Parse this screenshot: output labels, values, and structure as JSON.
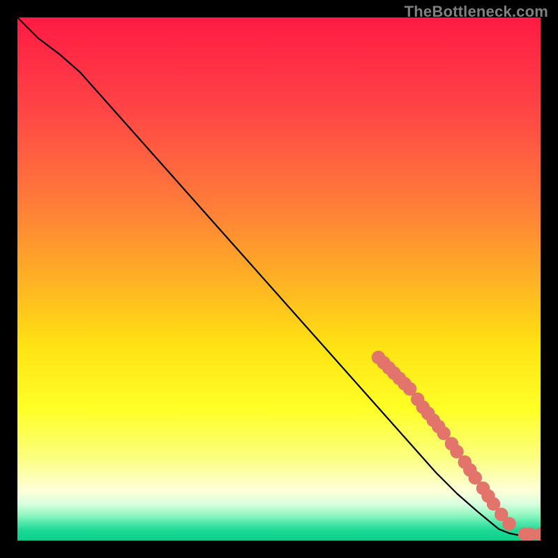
{
  "watermark": "TheBottleneck.com",
  "chart_data": {
    "type": "line",
    "title": "",
    "xlabel": "",
    "ylabel": "",
    "xlim": [
      0,
      100
    ],
    "ylim": [
      0,
      100
    ],
    "grid": false,
    "legend": false,
    "series": [
      {
        "name": "curve",
        "x": [
          0,
          4,
          8,
          12,
          16,
          20,
          24,
          28,
          32,
          36,
          40,
          44,
          48,
          52,
          56,
          60,
          64,
          68,
          72,
          76,
          80,
          84,
          88,
          92,
          94,
          96,
          98,
          100
        ],
        "y": [
          100,
          96,
          93,
          89.5,
          85,
          80.5,
          76,
          71.5,
          67,
          62.5,
          58,
          53.5,
          49,
          44.5,
          40,
          35.5,
          31,
          26.5,
          22,
          17.5,
          13,
          9,
          5.5,
          2.2,
          1.4,
          1.0,
          1.0,
          1.0
        ]
      }
    ],
    "markers": {
      "color": "#e2746b",
      "radius_norm": 0.013,
      "points": [
        {
          "x": 69,
          "y": 35
        },
        {
          "x": 70,
          "y": 34
        },
        {
          "x": 71,
          "y": 33
        },
        {
          "x": 72,
          "y": 32
        },
        {
          "x": 73,
          "y": 31
        },
        {
          "x": 74,
          "y": 30
        },
        {
          "x": 75,
          "y": 29
        },
        {
          "x": 76.5,
          "y": 27
        },
        {
          "x": 77.5,
          "y": 25.5
        },
        {
          "x": 78.5,
          "y": 24.3
        },
        {
          "x": 79.5,
          "y": 23.0
        },
        {
          "x": 80.5,
          "y": 21.8
        },
        {
          "x": 81.5,
          "y": 20.5
        },
        {
          "x": 83,
          "y": 18.5
        },
        {
          "x": 84,
          "y": 17
        },
        {
          "x": 85.5,
          "y": 15
        },
        {
          "x": 86.5,
          "y": 13.5
        },
        {
          "x": 87.5,
          "y": 12
        },
        {
          "x": 89,
          "y": 10
        },
        {
          "x": 90,
          "y": 8.5
        },
        {
          "x": 91,
          "y": 7
        },
        {
          "x": 92.5,
          "y": 5
        },
        {
          "x": 94,
          "y": 3.2
        },
        {
          "x": 97,
          "y": 1.2
        },
        {
          "x": 98,
          "y": 1.2
        },
        {
          "x": 100,
          "y": 1.2
        }
      ]
    },
    "background_gradient": {
      "stops": [
        {
          "offset": 0.0,
          "color": "#ff1a44"
        },
        {
          "offset": 0.18,
          "color": "#ff4646"
        },
        {
          "offset": 0.35,
          "color": "#ff7a3a"
        },
        {
          "offset": 0.5,
          "color": "#ffb024"
        },
        {
          "offset": 0.63,
          "color": "#ffe313"
        },
        {
          "offset": 0.75,
          "color": "#ffff27"
        },
        {
          "offset": 0.84,
          "color": "#fbff7d"
        },
        {
          "offset": 0.905,
          "color": "#fdffd8"
        },
        {
          "offset": 0.93,
          "color": "#d8ffde"
        },
        {
          "offset": 0.95,
          "color": "#96f7c2"
        },
        {
          "offset": 0.965,
          "color": "#55e9ad"
        },
        {
          "offset": 0.98,
          "color": "#1fd997"
        },
        {
          "offset": 1.0,
          "color": "#0ace8a"
        }
      ]
    }
  }
}
